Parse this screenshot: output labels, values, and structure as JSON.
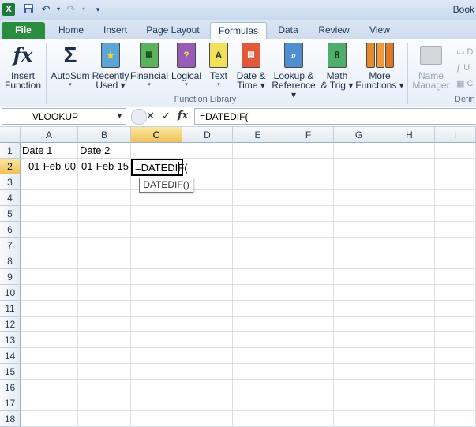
{
  "titlebar": {
    "book_title": "Book"
  },
  "tabs": [
    {
      "label": "File"
    },
    {
      "label": "Home"
    },
    {
      "label": "Insert"
    },
    {
      "label": "Page Layout"
    },
    {
      "label": "Formulas"
    },
    {
      "label": "Data"
    },
    {
      "label": "Review"
    },
    {
      "label": "View"
    }
  ],
  "ribbon": {
    "buttons": [
      {
        "line1": "Insert",
        "line2": "Function"
      },
      {
        "line1": "AutoSum",
        "line2": "▾"
      },
      {
        "line1": "Recently",
        "line2": "Used ▾"
      },
      {
        "line1": "Financial",
        "line2": "▾"
      },
      {
        "line1": "Logical",
        "line2": "▾"
      },
      {
        "line1": "Text",
        "line2": "▾"
      },
      {
        "line1": "Date &",
        "line2": "Time ▾"
      },
      {
        "line1": "Lookup &",
        "line2": "Reference ▾"
      },
      {
        "line1": "Math",
        "line2": "& Trig ▾"
      },
      {
        "line1": "More",
        "line2": "Functions ▾"
      },
      {
        "line1": "Name",
        "line2": "Manager"
      }
    ],
    "group_label": "Function Library",
    "group_label_2": "Defin",
    "side_items": [
      "D",
      "U",
      "C"
    ]
  },
  "formula_bar": {
    "name_box": "VLOOKUP",
    "formula": "=DATEDIF("
  },
  "grid": {
    "columns": [
      "A",
      "B",
      "C",
      "D",
      "E",
      "F",
      "G",
      "H",
      "I"
    ],
    "rows": [
      "1",
      "2",
      "3",
      "4",
      "5",
      "6",
      "7",
      "8",
      "9",
      "10",
      "11",
      "12",
      "13",
      "14",
      "15",
      "16",
      "17",
      "18"
    ],
    "cells": {
      "A1": "Date 1",
      "B1": "Date 2",
      "A2": "01-Feb-00",
      "B2": "01-Feb-15",
      "C2": "=DATEDIF("
    },
    "tooltip": "DATEDIF()"
  },
  "colors": {
    "file_tab": "#2a8c3d",
    "selected_header": "#f1c15b"
  }
}
